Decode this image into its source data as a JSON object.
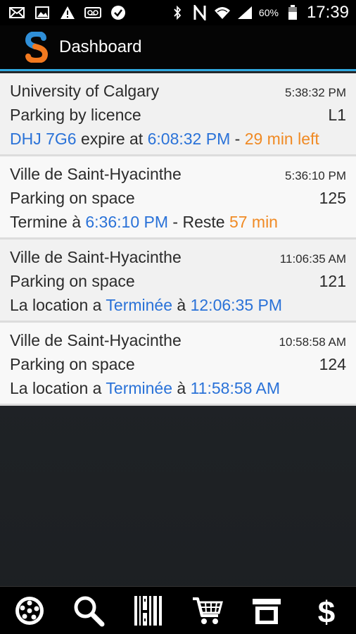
{
  "status_bar": {
    "battery_percent": "60%",
    "time": "17:39",
    "left_icons": [
      "mail-icon",
      "image-icon",
      "warning-icon",
      "voicemail-icon",
      "check-icon"
    ],
    "right_icons": [
      "bluetooth-icon",
      "nfc-icon",
      "wifi-icon",
      "signal-icon",
      "battery-icon"
    ]
  },
  "action_bar": {
    "title": "Dashboard",
    "accent": "#30a9e0",
    "logo_colors": [
      "#2f8fd8",
      "#f2791f"
    ]
  },
  "list": [
    {
      "title": "University of Calgary",
      "time": "5:38:32 PM",
      "subtitle": "Parking by licence",
      "code": "L1",
      "line3": [
        {
          "text": "DHJ 7G6",
          "color": "blue"
        },
        {
          "text": " expire at ",
          "color": "dark"
        },
        {
          "text": "6:08:32 PM",
          "color": "blue"
        },
        {
          "text": " - ",
          "color": "dark"
        },
        {
          "text": "29 min left",
          "color": "orange"
        }
      ]
    },
    {
      "title": "Ville de Saint-Hyacinthe",
      "time": "5:36:10 PM",
      "subtitle": "Parking on space",
      "code": "125",
      "line3": [
        {
          "text": "Termine à ",
          "color": "dark"
        },
        {
          "text": "6:36:10 PM",
          "color": "blue"
        },
        {
          "text": " - Reste ",
          "color": "dark"
        },
        {
          "text": "57 min",
          "color": "orange"
        }
      ]
    },
    {
      "title": "Ville de Saint-Hyacinthe",
      "time": "11:06:35 AM",
      "subtitle": "Parking on space",
      "code": "121",
      "line3": [
        {
          "text": "La location a ",
          "color": "dark"
        },
        {
          "text": "Terminée",
          "color": "blue"
        },
        {
          "text": " à ",
          "color": "dark"
        },
        {
          "text": "12:06:35 PM",
          "color": "blue"
        }
      ]
    },
    {
      "title": "Ville de Saint-Hyacinthe",
      "time": "10:58:58 AM",
      "subtitle": "Parking on space",
      "code": "124",
      "line3": [
        {
          "text": "La location a ",
          "color": "dark"
        },
        {
          "text": "Terminée",
          "color": "blue"
        },
        {
          "text": " à ",
          "color": "dark"
        },
        {
          "text": "11:58:58 AM",
          "color": "blue"
        }
      ]
    }
  ],
  "bottom_nav": [
    "map-icon",
    "search-icon",
    "barcode-icon",
    "cart-icon",
    "archive-icon",
    "dollar-icon"
  ],
  "colors": {
    "blue": "#2a72d8",
    "orange": "#f08a24"
  }
}
